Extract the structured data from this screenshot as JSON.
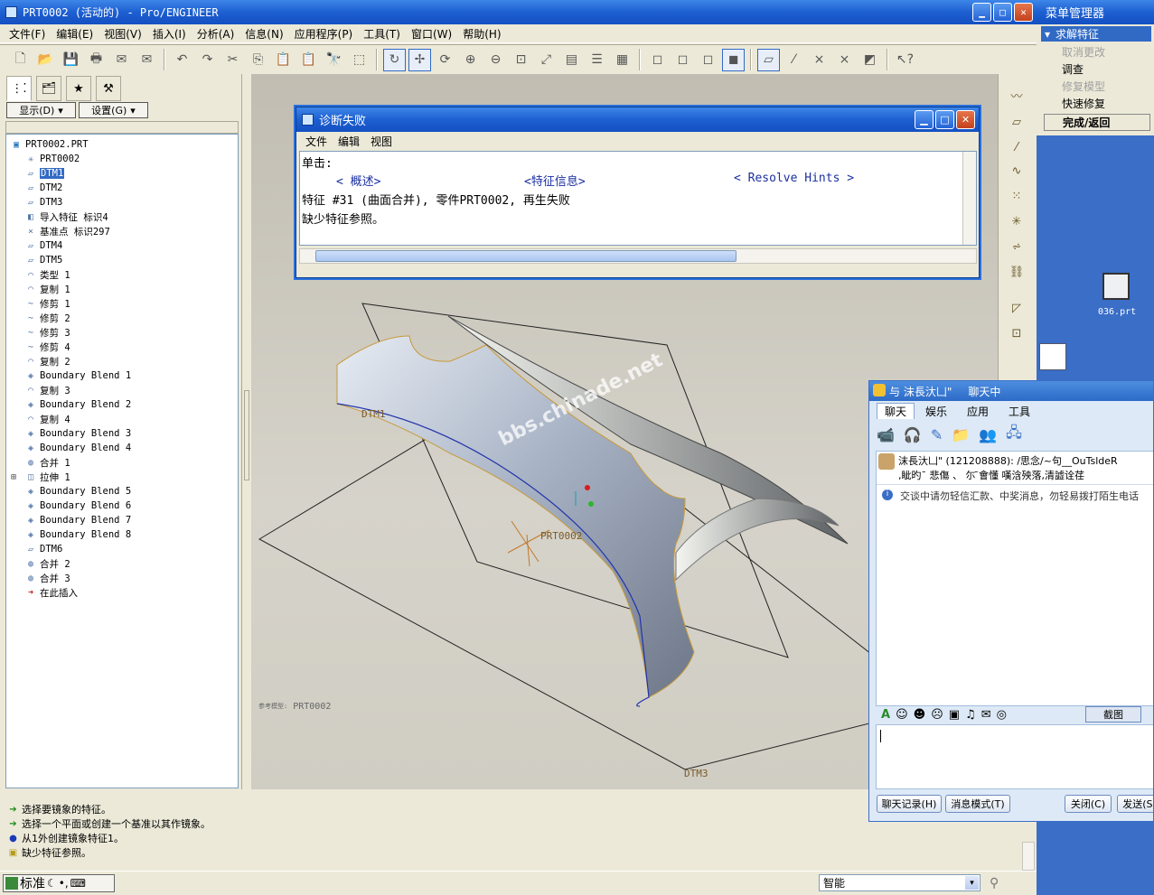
{
  "app": {
    "title": "PRT0002 (活动的) - Pro/ENGINEER"
  },
  "menubar": [
    "文件(F)",
    "编辑(E)",
    "视图(V)",
    "插入(I)",
    "分析(A)",
    "信息(N)",
    "应用程序(P)",
    "工具(T)",
    "窗口(W)",
    "帮助(H)"
  ],
  "left_panel": {
    "show_button": "显示(D)",
    "settings_button": "设置(G)",
    "tree": [
      {
        "label": "PRT0002.PRT",
        "icon": "part-icon",
        "indent": 0
      },
      {
        "label": "PRT0002",
        "icon": "csys-icon",
        "indent": 1
      },
      {
        "label": "DTM1",
        "icon": "datum-plane-icon",
        "indent": 1,
        "selected": true
      },
      {
        "label": "DTM2",
        "icon": "datum-plane-icon",
        "indent": 1
      },
      {
        "label": "DTM3",
        "icon": "datum-plane-icon",
        "indent": 1
      },
      {
        "label": "导入特征 标识4",
        "icon": "import-feature-icon",
        "indent": 1
      },
      {
        "label": "基准点 标识297",
        "icon": "datum-point-icon",
        "indent": 1
      },
      {
        "label": "DTM4",
        "icon": "datum-plane-icon",
        "indent": 1
      },
      {
        "label": "DTM5",
        "icon": "datum-plane-icon",
        "indent": 1
      },
      {
        "label": "类型 1",
        "icon": "surface-icon",
        "indent": 1
      },
      {
        "label": "复制 1",
        "icon": "copy-icon",
        "indent": 1
      },
      {
        "label": "修剪 1",
        "icon": "trim-icon",
        "indent": 1
      },
      {
        "label": "修剪 2",
        "icon": "trim-icon",
        "indent": 1
      },
      {
        "label": "修剪 3",
        "icon": "trim-icon",
        "indent": 1
      },
      {
        "label": "修剪 4",
        "icon": "trim-icon",
        "indent": 1
      },
      {
        "label": "复制 2",
        "icon": "copy-icon",
        "indent": 1
      },
      {
        "label": "Boundary Blend 1",
        "icon": "boundary-blend-icon",
        "indent": 1
      },
      {
        "label": "复制 3",
        "icon": "copy-icon",
        "indent": 1
      },
      {
        "label": "Boundary Blend 2",
        "icon": "boundary-blend-icon",
        "indent": 1
      },
      {
        "label": "复制 4",
        "icon": "copy-icon",
        "indent": 1
      },
      {
        "label": "Boundary Blend 3",
        "icon": "boundary-blend-icon",
        "indent": 1
      },
      {
        "label": "Boundary Blend 4",
        "icon": "boundary-blend-icon",
        "indent": 1
      },
      {
        "label": "合并 1",
        "icon": "merge-icon",
        "indent": 1
      },
      {
        "label": "拉伸 1",
        "icon": "extrude-icon",
        "indent": 1,
        "expandable": true
      },
      {
        "label": "Boundary Blend 5",
        "icon": "boundary-blend-icon",
        "indent": 1
      },
      {
        "label": "Boundary Blend 6",
        "icon": "boundary-blend-icon",
        "indent": 1
      },
      {
        "label": "Boundary Blend 7",
        "icon": "boundary-blend-icon",
        "indent": 1
      },
      {
        "label": "Boundary Blend 8",
        "icon": "boundary-blend-icon",
        "indent": 1
      },
      {
        "label": "DTM6",
        "icon": "datum-plane-icon",
        "indent": 1
      },
      {
        "label": "合并 2",
        "icon": "merge-icon",
        "indent": 1
      },
      {
        "label": "合并 3",
        "icon": "merge-failed-icon",
        "indent": 1,
        "failed": true
      },
      {
        "label": "在此插入",
        "icon": "insert-here-icon",
        "indent": 1
      }
    ]
  },
  "diagnostics": {
    "title": "诊断失败",
    "menu": [
      "文件",
      "编辑",
      "视图"
    ],
    "click_label": "单击:",
    "link_overview": "< 概述>",
    "link_feature_info": "<特征信息>",
    "link_resolve": "< Resolve Hints >",
    "line1": "特征 #31 (曲面合并), 零件PRT0002,  再生失败",
    "line2": "缺少特征参照。"
  },
  "viewport": {
    "watermark": "bbs.chinade.net",
    "dtm1": "DTM1",
    "dtm3": "DTM3",
    "csys_label": "PRT0002",
    "model_label_prefix": "参考模型:",
    "model_label": "PRT0002"
  },
  "messages": [
    {
      "icon": "arrow-green-icon",
      "text": "选择要镜象的特征。"
    },
    {
      "icon": "arrow-green-icon",
      "text": "选择一个平面或创建一个基准以其作镜象。"
    },
    {
      "icon": "bullet-blue-icon",
      "text": "从1外创建镜象特征1。"
    },
    {
      "icon": "warning-icon",
      "text": "缺少特征参照。"
    }
  ],
  "statusbar": {
    "ime": "标准",
    "mode": "智能"
  },
  "menu_manager": {
    "title": "菜单管理器",
    "section": "求解特征",
    "items": [
      {
        "label": "取消更改",
        "enabled": false
      },
      {
        "label": "调查",
        "enabled": true
      },
      {
        "label": "修复模型",
        "enabled": false
      },
      {
        "label": "快速修复",
        "enabled": true
      },
      {
        "label": "完成/返回",
        "enabled": true,
        "bold": true
      }
    ]
  },
  "desktop": {
    "icon1_label": "036.prt"
  },
  "qq": {
    "title_prefix": "与 沫長汏凵\"",
    "title_status": "聊天中",
    "tabs": [
      "聊天",
      "娱乐",
      "应用",
      "工具"
    ],
    "contact_line1": "沫長汏凵\" (121208888): /思念/~句__OuTsldeR",
    "contact_line2": ",眦旳¯ 悲傷 、 尓 ̄會懂 嘆浛殃落,清譃诠荏",
    "notice": "交谈中请勿轻信汇款、中奖消息，勿轻易拨打陌生电话",
    "screenshot_btn": "截图",
    "btn_history": "聊天记录(H)",
    "btn_msgmode": "消息模式(T)",
    "btn_close": "关闭(C)",
    "btn_send": "发送(S)"
  }
}
